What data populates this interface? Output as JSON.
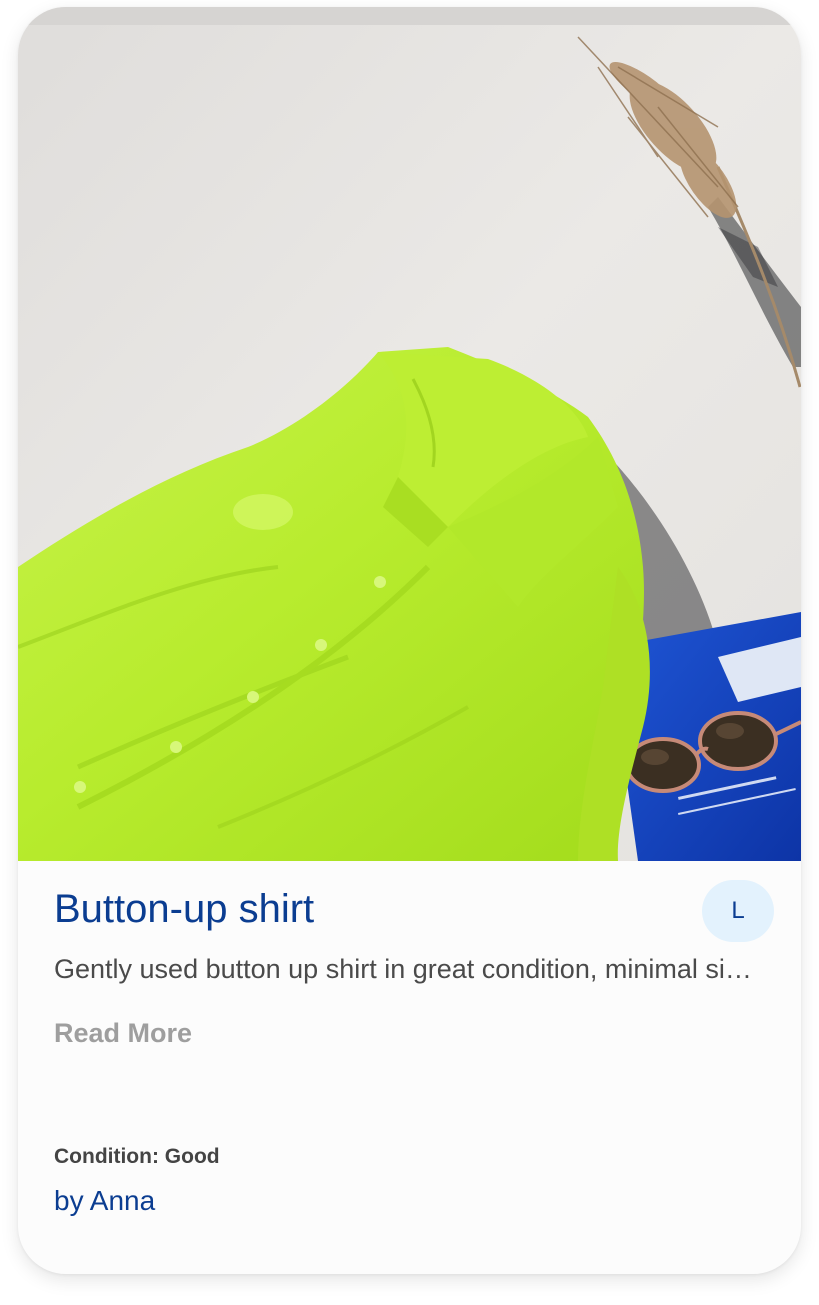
{
  "listing": {
    "title": "Button-up shirt",
    "description": "Gently used button up shirt in great condition, minimal signs of wear.",
    "read_more_label": "Read More",
    "condition_text": "Condition: Good",
    "author_text": "by Anna",
    "avatar_initial": "L",
    "photo_alt": "Lime green button-up shirt on a white wall with sunglasses, a blue magazine and dried pampas grass"
  },
  "colors": {
    "title": "#0b3d91",
    "avatar_bg": "#e3f2fd",
    "shirt": "#c6f03b",
    "magazine": "#1747c9",
    "wall": "#e8e6e2"
  }
}
